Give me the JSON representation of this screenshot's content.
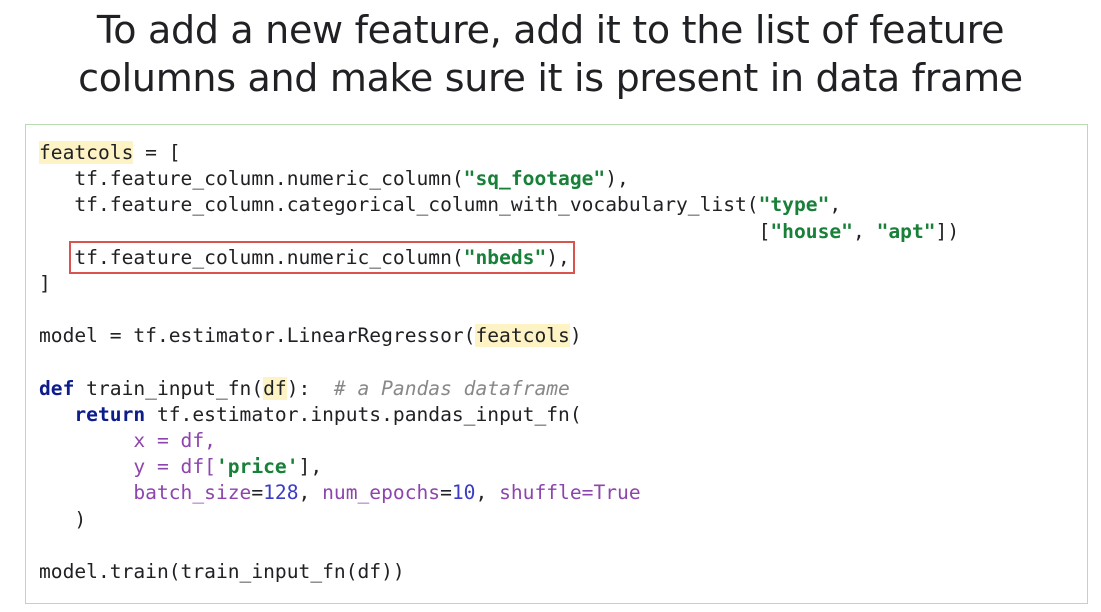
{
  "title": {
    "line1": "To add a new feature, add it to the list of feature",
    "line2": "columns and make sure it is present in data frame"
  },
  "code": {
    "featcols_name": "featcols",
    "assign_open": " = [",
    "nc_prefix": "   tf.feature_column.numeric_column(",
    "sq_footage": "\"sq_footage\"",
    "nc_suffix": "),",
    "cat_prefix": "   tf.feature_column.categorical_column_with_vocabulary_list(",
    "type_str": "\"type\"",
    "comma": ",",
    "indent_vocab": "                                                             [",
    "house_str": "\"house\"",
    "comma_space": ", ",
    "apt_str": "\"apt\"",
    "vocab_close": "])",
    "indent3": "   ",
    "nbeds_prefix": "tf.feature_column.numeric_column(",
    "nbeds_str": "\"nbeds\"",
    "nbeds_suffix": "),",
    "list_close": "]",
    "model_prefix": "model = tf.estimator.LinearRegressor(",
    "featcols_arg": "featcols",
    "close_paren": ")",
    "def_kw": "def",
    "fn_name": " train_input_fn(",
    "df_param": "df",
    "fn_sig_close": "):  ",
    "comment": "# a Pandas dataframe",
    "return_kw": "return",
    "return_rest": " tf.estimator.inputs.pandas_input_fn(",
    "indent8": "        ",
    "x_line": "x = df,",
    "y_prefix": "y = df[",
    "price_str": "'price'",
    "y_suffix": "],",
    "batch_kw": "batch_size",
    "eq": "=",
    "batch_val": "128",
    "num_epochs_kw": "num_epochs",
    "num_epochs_val": "10",
    "shuffle_kw": "shuffle",
    "shuffle_val": "True",
    "paren_close_line": "   )",
    "train_line": "model.train(train_input_fn(df))"
  },
  "colors": {
    "string": "#188038",
    "keyword": "#0d1e8c",
    "argument": "#8e44ad",
    "number": "#3b3cc4",
    "comment": "#888888",
    "highlight": "#fdf3c4",
    "box_border": "#b6dcb0",
    "callout_border": "#d9534f"
  }
}
